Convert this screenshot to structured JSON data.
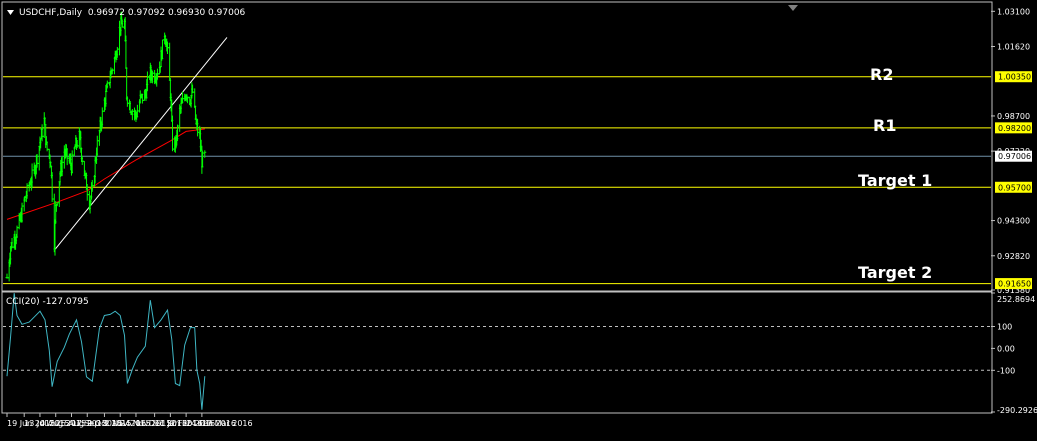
{
  "main_chart": {
    "symbol_line": "USDCHF,Daily  0.96972 0.97092 0.96930 0.97006",
    "price_axis_ticks": [
      "1.03100",
      "1.01620",
      "0.98700",
      "0.97220",
      "0.94300",
      "0.92820",
      "0.91380"
    ],
    "level_badges": [
      {
        "label": "1.00350",
        "color": "#ffff00"
      },
      {
        "label": "0.98200",
        "color": "#ffff00"
      },
      {
        "label": "0.97006",
        "color": "#ffffff"
      },
      {
        "label": "0.95700",
        "color": "#ffff00"
      },
      {
        "label": "0.91650",
        "color": "#ffff00"
      }
    ],
    "annotations": [
      "R2",
      "R1",
      "Target 1",
      "Target 2"
    ]
  },
  "cci_panel": {
    "title": "CCI(20) -127.0795",
    "axis_ticks": [
      "252.8694",
      "100",
      "0.00",
      "-100",
      "-290.2926"
    ]
  },
  "time_axis": {
    "labels": [
      "19 Jun 2015",
      "13 Jul 2015",
      "4 Aug 2015",
      "26 Aug 2015",
      "17 Sep 2015",
      "9 Oct 2015",
      "2 Nov 2015",
      "24 Nov 2015",
      "16 Dec 2015",
      "11 Jan 2016",
      "2 Feb 2016",
      "24 Feb 2016",
      "17 Mar 2016"
    ]
  },
  "chart_data": [
    {
      "type": "ohlc-bars",
      "title": "USDCHF,Daily",
      "last_quote": {
        "open": 0.96972,
        "high": 0.97092,
        "low": 0.9693,
        "close": 0.97006
      },
      "ylim": [
        0.9138,
        1.0345
      ],
      "x_labels": [
        "19 Jun 2015",
        "13 Jul 2015",
        "4 Aug 2015",
        "26 Aug 2015",
        "17 Sep 2015",
        "9 Oct 2015",
        "2 Nov 2015",
        "24 Nov 2015",
        "16 Dec 2015",
        "11 Jan 2016",
        "2 Feb 2016",
        "24 Feb 2016",
        "17 Mar 2016"
      ],
      "close_path": [
        [
          "19 Jun 2015",
          0.919
        ],
        [
          "24 Jun 2015",
          0.932
        ],
        [
          "1 Jul 2015",
          0.937
        ],
        [
          "8 Jul 2015",
          0.944
        ],
        [
          "13 Jul 2015",
          0.951
        ],
        [
          "20 Jul 2015",
          0.958
        ],
        [
          "27 Jul 2015",
          0.964
        ],
        [
          "4 Aug 2015",
          0.976
        ],
        [
          "10 Aug 2015",
          0.985
        ],
        [
          "13 Aug 2015",
          0.974
        ],
        [
          "19 Aug 2015",
          0.968
        ],
        [
          "24 Aug 2015",
          0.934
        ],
        [
          "26 Aug 2015",
          0.948
        ],
        [
          "1 Sep 2015",
          0.963
        ],
        [
          "7 Sep 2015",
          0.972
        ],
        [
          "17 Sep 2015",
          0.966
        ],
        [
          "22 Sep 2015",
          0.974
        ],
        [
          "28 Sep 2015",
          0.978
        ],
        [
          "5 Oct 2015",
          0.963
        ],
        [
          "12 Oct 2015",
          0.951
        ],
        [
          "16 Oct 2015",
          0.955
        ],
        [
          "22 Oct 2015",
          0.973
        ],
        [
          "2 Nov 2015",
          0.993
        ],
        [
          "10 Nov 2015",
          1.004
        ],
        [
          "17 Nov 2015",
          1.012
        ],
        [
          "24 Nov 2015",
          1.025
        ],
        [
          "30 Nov 2015",
          1.026
        ],
        [
          "3 Dec 2015",
          0.996
        ],
        [
          "8 Dec 2015",
          0.991
        ],
        [
          "16 Dec 2015",
          0.987
        ],
        [
          "22 Dec 2015",
          0.994
        ],
        [
          "29 Dec 2015",
          0.996
        ],
        [
          "4 Jan 2016",
          1.005
        ],
        [
          "11 Jan 2016",
          1.004
        ],
        [
          "18 Jan 2016",
          1.008
        ],
        [
          "25 Jan 2016",
          1.022
        ],
        [
          "28 Jan 2016",
          1.017
        ],
        [
          "2 Feb 2016",
          0.997
        ],
        [
          "5 Feb 2016",
          0.975
        ],
        [
          "10 Feb 2016",
          0.976
        ],
        [
          "15 Feb 2016",
          0.989
        ],
        [
          "24 Feb 2016",
          0.997
        ],
        [
          "29 Feb 2016",
          0.994
        ],
        [
          "4 Mar 2016",
          0.997
        ],
        [
          "9 Mar 2016",
          0.983
        ],
        [
          "14 Mar 2016",
          0.978
        ],
        [
          "17 Mar 2016",
          0.968
        ],
        [
          "21 Mar 2016",
          0.97
        ]
      ],
      "series": [
        {
          "name": "",
          "kind": "moving-average",
          "color": "#ff0000",
          "points": [
            [
              "19 Jun 2015",
              0.9435
            ],
            [
              "26 Aug 2015",
              0.9505
            ],
            [
              "9 Oct 2015",
              0.9555
            ],
            [
              "2 Nov 2015",
              0.9605
            ],
            [
              "16 Dec 2015",
              0.9685
            ],
            [
              "2 Feb 2016",
              0.9765
            ],
            [
              "24 Feb 2016",
              0.9805
            ],
            [
              "21 Mar 2016",
              0.9815
            ]
          ]
        }
      ],
      "trendlines": [
        {
          "kind": "rising trendline",
          "color": "#ffffff",
          "points": [
            [
              "24 Aug 2015",
              0.9305
            ],
            [
              "21 Apr 2016",
              1.02
            ]
          ]
        }
      ],
      "horizontal_levels": [
        {
          "label": "R2",
          "value": 1.0035,
          "color": "#ffff00"
        },
        {
          "label": "R1",
          "value": 0.982,
          "color": "#ffff00"
        },
        {
          "label": "",
          "value": 0.97006,
          "color": "#6f8fa8"
        },
        {
          "label": "Target 1",
          "value": 0.957,
          "color": "#ffff00"
        },
        {
          "label": "Target 2",
          "value": 0.9165,
          "color": "#ffff00"
        }
      ],
      "bar_color": "#00ff00",
      "grid": false
    },
    {
      "type": "line",
      "title": "CCI(20) -127.0795",
      "series": [
        {
          "name": "",
          "color": "#3fb6c4",
          "points": [
            [
              "19 Jun 2015",
              -127
            ],
            [
              "24 Jun 2015",
              55
            ],
            [
              "29 Jun 2015",
              252
            ],
            [
              "3 Jul 2015",
              150
            ],
            [
              "10 Jul 2015",
              110
            ],
            [
              "20 Jul 2015",
              120
            ],
            [
              "4 Aug 2015",
              170
            ],
            [
              "11 Aug 2015",
              130
            ],
            [
              "17 Aug 2015",
              -10
            ],
            [
              "21 Aug 2015",
              -175
            ],
            [
              "28 Aug 2015",
              -60
            ],
            [
              "7 Sep 2015",
              5
            ],
            [
              "14 Sep 2015",
              65
            ],
            [
              "24 Sep 2015",
              130
            ],
            [
              "1 Oct 2015",
              30
            ],
            [
              "8 Oct 2015",
              -130
            ],
            [
              "16 Oct 2015",
              -150
            ],
            [
              "26 Oct 2015",
              90
            ],
            [
              "2 Nov 2015",
              150
            ],
            [
              "10 Nov 2015",
              155
            ],
            [
              "17 Nov 2015",
              170
            ],
            [
              "24 Nov 2015",
              150
            ],
            [
              "30 Nov 2015",
              60
            ],
            [
              "4 Dec 2015",
              -160
            ],
            [
              "11 Dec 2015",
              -95
            ],
            [
              "18 Dec 2015",
              -40
            ],
            [
              "29 Dec 2015",
              10
            ],
            [
              "5 Jan 2016",
              220
            ],
            [
              "11 Jan 2016",
              95
            ],
            [
              "20 Jan 2016",
              130
            ],
            [
              "29 Jan 2016",
              175
            ],
            [
              "4 Feb 2016",
              40
            ],
            [
              "9 Feb 2016",
              -160
            ],
            [
              "15 Feb 2016",
              -170
            ],
            [
              "22 Feb 2016",
              15
            ],
            [
              "1 Mar 2016",
              95
            ],
            [
              "7 Mar 2016",
              95
            ],
            [
              "10 Mar 2016",
              -100
            ],
            [
              "14 Mar 2016",
              -160
            ],
            [
              "17 Mar 2016",
              -280
            ],
            [
              "21 Mar 2016",
              -127
            ]
          ]
        }
      ],
      "reference_lines": [
        100,
        -100
      ],
      "ylim": [
        -290.2926,
        252.8694
      ]
    }
  ]
}
